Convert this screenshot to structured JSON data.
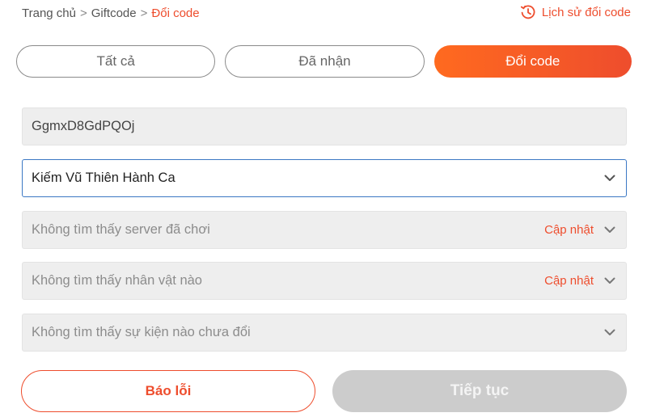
{
  "breadcrumb": {
    "items": [
      "Trang chủ",
      "Giftcode"
    ],
    "separator": ">",
    "current": "Đổi code"
  },
  "history_link": {
    "label": "Lịch sử đổi code",
    "icon": "history-clock-icon"
  },
  "tabs": [
    {
      "label": "Tất cả",
      "active": false
    },
    {
      "label": "Đã nhận",
      "active": false
    },
    {
      "label": "Đổi code",
      "active": true
    }
  ],
  "form": {
    "code_value": "GgmxD8GdPQOj",
    "game_select": {
      "value": "Kiếm Vũ Thiên Hành Ca"
    },
    "server_select": {
      "placeholder": "Không tìm thấy server đã chơi",
      "refresh_label": "Cập nhật"
    },
    "character_select": {
      "placeholder": "Không tìm thấy nhân vật nào",
      "refresh_label": "Cập nhật"
    },
    "event_select": {
      "placeholder": "Không tìm thấy sự kiện nào chưa đổi"
    }
  },
  "buttons": {
    "report_label": "Báo lỗi",
    "next_label": "Tiếp tục"
  },
  "colors": {
    "accent": "#ee4d2d",
    "accent_gradient_start": "#ff6a1f",
    "focus_border": "#3b78c4",
    "disabled_button": "#cccccc"
  }
}
